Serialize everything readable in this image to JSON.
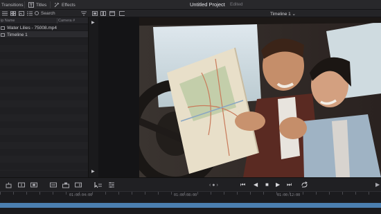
{
  "toolbar": {
    "transitions_label": "Transitions",
    "titles_label": "Titles",
    "effects_label": "Effects",
    "project_title": "Untitled Project",
    "project_status": "Edited"
  },
  "subbar": {
    "search_label": "Search",
    "timeline_selector": "Timeline 1 ⌄"
  },
  "media_pool": {
    "columns": [
      "ip Name",
      "Camera #"
    ],
    "items": [
      {
        "label": "Water Lilies - 75008.mp4",
        "type": "video"
      },
      {
        "label": "Timeline 1",
        "type": "timeline"
      }
    ]
  },
  "transport": {
    "jog_label": "‹ ● ›"
  },
  "ruler": {
    "timecodes": [
      "01:00:04:00",
      "01:00:08:00",
      "01:00:12:00"
    ]
  },
  "colors": {
    "accent_blue": "#4b7fb0",
    "panel_bg": "#1f1f22"
  }
}
